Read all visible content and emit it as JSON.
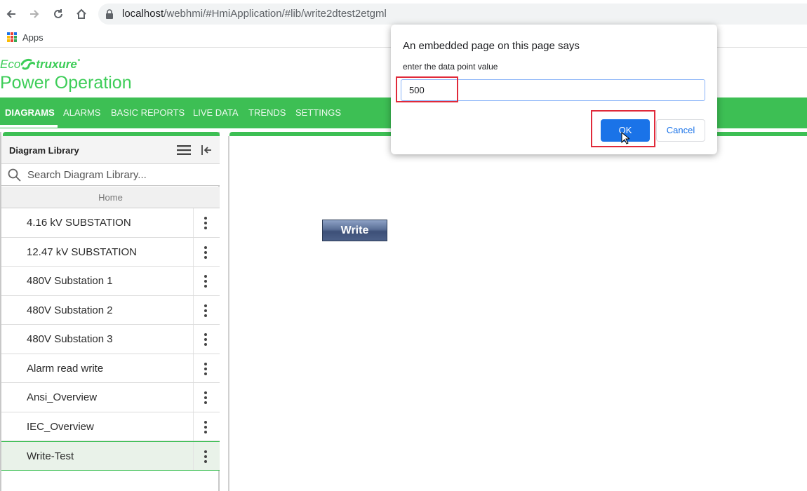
{
  "browser": {
    "url_host": "localhost",
    "url_path": "/webhmi/#HmiApplication/#lib/write2dtest2etgml",
    "apps_label": "Apps"
  },
  "app": {
    "brand_eco": "Eco",
    "brand_struxure": "truxure",
    "brand_tm": "°",
    "title": "Power Operation",
    "accent_color": "#3dbf54"
  },
  "menu": {
    "items": [
      "DIAGRAMS",
      "ALARMS",
      "BASIC REPORTS",
      "LIVE DATA",
      "TRENDS",
      "SETTINGS"
    ],
    "active": "DIAGRAMS"
  },
  "sidebar": {
    "title": "Diagram Library",
    "search_placeholder": "Search Diagram Library...",
    "home_label": "Home",
    "items": [
      {
        "label": "4.16 kV SUBSTATION"
      },
      {
        "label": "12.47 kV SUBSTATION"
      },
      {
        "label": "480V Substation 1"
      },
      {
        "label": "480V Substation 2"
      },
      {
        "label": "480V Substation 3"
      },
      {
        "label": "Alarm read write"
      },
      {
        "label": "Ansi_Overview"
      },
      {
        "label": "IEC_Overview"
      },
      {
        "label": "Write-Test"
      }
    ],
    "selected": "Write-Test"
  },
  "main": {
    "write_button_label": "Write"
  },
  "dialog": {
    "title": "An embedded page on this page says",
    "message": "enter the data point value",
    "input_value": "500",
    "ok_label": "OK",
    "cancel_label": "Cancel"
  }
}
